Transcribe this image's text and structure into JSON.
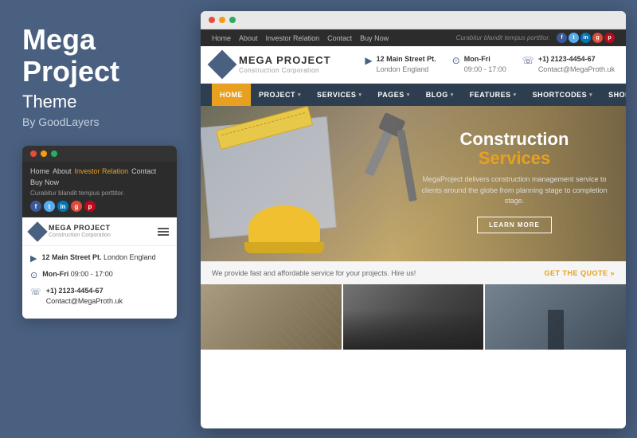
{
  "left": {
    "title": "Mega\nProject",
    "subtitle": "Theme",
    "by": "By GoodLayers"
  },
  "mobile": {
    "nav_links": [
      "Home",
      "About",
      "Investor Relation",
      "Contact",
      "Buy Now"
    ],
    "tagline": "Curabitur blandit tempus porttitor.",
    "logo_name": "MEGA PROJECT",
    "logo_corp": "Construction Corporation",
    "info": [
      {
        "icon": "📍",
        "label": "12 Main Street Pt.",
        "detail": "London England"
      },
      {
        "icon": "🕐",
        "label": "Mon-Fri",
        "detail": "09:00 - 17:00"
      },
      {
        "icon": "📞",
        "label": "+1) 2123-4454-67",
        "detail": "Contact@MegaProth.uk"
      }
    ]
  },
  "browser": {
    "topbar": {
      "links": [
        "Home",
        "About",
        "Investor Relation",
        "Contact",
        "Buy Now"
      ],
      "tagline": "Curabitur blandit tempus porttitor.",
      "social": [
        "f",
        "t",
        "in",
        "g+",
        "p"
      ]
    },
    "header": {
      "logo_name": "MEGA PROJECT",
      "logo_corp": "Construction Corporation",
      "address_label": "12 Main Street Pt.",
      "address_detail": "London England",
      "hours_label": "Mon-Fri",
      "hours_detail": "09:00 - 17:00",
      "phone_label": "+1) 2123-4454-67",
      "phone_detail": "Contact@MegaProth.uk"
    },
    "nav": {
      "items": [
        "HOME",
        "PROJECT",
        "SERVICES",
        "PAGES",
        "BLOG",
        "FEATURES",
        "SHORTCODES",
        "SHOP"
      ]
    },
    "hero": {
      "title_line1": "Construction",
      "title_line2": "Services",
      "description": "MegaProject delivers construction management service to\nclients around the globe from planning stage to completion\nstage.",
      "cta_label": "LEARN MORE"
    },
    "quote_bar": {
      "text": "We provide fast and affordable service for your projects. Hire us!",
      "cta": "GET THE QUOTE »"
    }
  }
}
